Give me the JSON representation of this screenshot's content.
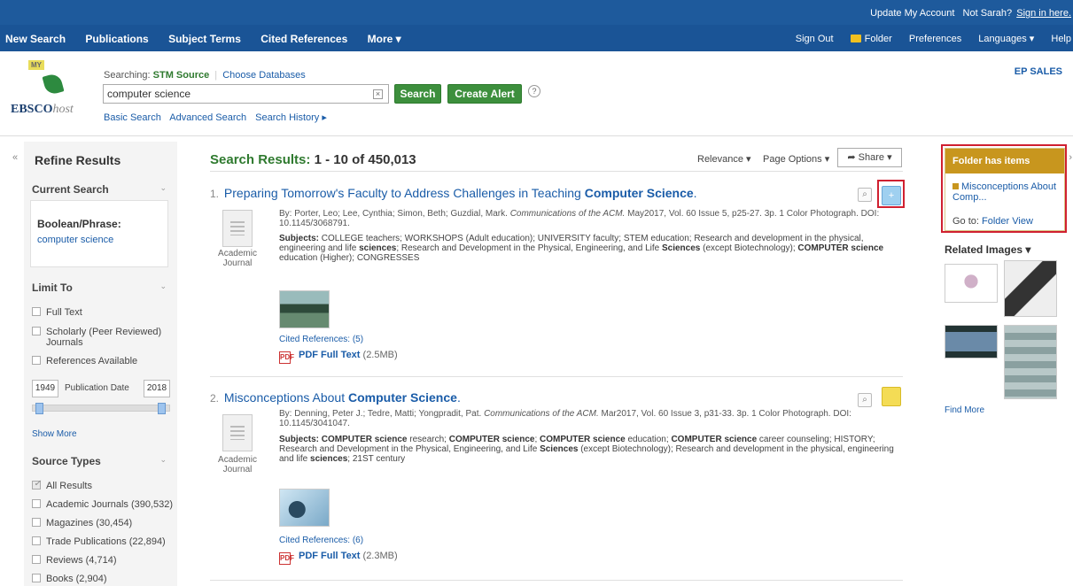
{
  "topbar": {
    "update_account": "Update My Account",
    "not_user": "Not Sarah?",
    "sign_in": "Sign in here."
  },
  "nav": {
    "left": [
      "New Search",
      "Publications",
      "Subject Terms",
      "Cited References",
      "More ▾"
    ],
    "sign_out": "Sign Out",
    "folder": "Folder",
    "preferences": "Preferences",
    "languages": "Languages ▾",
    "help": "Help"
  },
  "header": {
    "logo_my": "MY",
    "logo_brand": "EBSCO",
    "logo_host": "host",
    "searching_label": "Searching:",
    "searching_source": "STM Source",
    "choose_db": "Choose Databases",
    "search_value": "computer science",
    "search_button": "Search",
    "alert_button": "Create Alert",
    "help_glyph": "?",
    "basic_search": "Basic Search",
    "advanced_search": "Advanced Search",
    "search_history": "Search History ▸",
    "ep_sales": "EP SALES"
  },
  "sidebar": {
    "refine": "Refine Results",
    "current_search": "Current Search",
    "boolean_label": "Boolean/Phrase:",
    "boolean_value": "computer science",
    "limit_to": "Limit To",
    "limits": [
      "Full Text",
      "Scholarly (Peer Reviewed)",
      "Journals",
      "References Available"
    ],
    "date_from": "1949",
    "date_label": "Publication Date",
    "date_to": "2018",
    "show_more": "Show More",
    "source_types": "Source Types",
    "sources": [
      "All Results",
      "Academic Journals (390,532)",
      "Magazines (30,454)",
      "Trade Publications (22,894)",
      "Reviews (4,714)",
      "Books (2,904)"
    ]
  },
  "results": {
    "heading": "Search Results:",
    "range": "1 - 10 of 450,013",
    "relevance": "Relevance ▾",
    "page_options": "Page Options ▾",
    "share": "Share ▾",
    "items": [
      {
        "num": "1.",
        "title_plain": "Preparing Tomorrow's Faculty to Address Challenges in Teaching ",
        "title_bold": "Computer Science",
        "title_end": ".",
        "meta_by": "By: Porter, Leo; Lee, Cynthia; Simon, Beth; Guzdial, Mark.",
        "meta_journal": "Communications of the ACM.",
        "meta_rest": "May2017, Vol. 60 Issue 5, p25-27. 3p. 1 Color Photograph. DOI:",
        "meta_doi": "10.1145/3068791.",
        "subjects_label": "Subjects:",
        "subjects_a": "COLLEGE teachers; WORKSHOPS (Adult education); UNIVERSITY faculty; STEM education; Research and development in the physical, engineering and life ",
        "subjects_b": "sciences",
        "subjects_c": "; Research and Development in the Physical, Engineering, and Life ",
        "subjects_d": "Sciences",
        "subjects_e": " (except Biotechnology); ",
        "subjects_f": "COMPUTER science",
        "subjects_g": " education (Higher); CONGRESSES",
        "type": "Academic Journal",
        "cited": "Cited References: (5)",
        "pdf_label": "PDF Full Text",
        "pdf_size": "(2.5MB)"
      },
      {
        "num": "2.",
        "title_plain": "Misconceptions About ",
        "title_bold": "Computer Science",
        "title_end": ".",
        "meta_by": "By: Denning, Peter J.; Tedre, Matti; Yongpradit, Pat.",
        "meta_journal": "Communications of the ACM.",
        "meta_rest": "Mar2017, Vol. 60 Issue 3, p31-33. 3p. 1 Color Photograph. DOI:",
        "meta_doi": "10.1145/3041047.",
        "subjects_label": "Subjects:",
        "subjects_a": "COMPUTER science",
        "subjects_b": " research; ",
        "subjects_c": "COMPUTER science",
        "subjects_d": "; ",
        "subjects_e": "COMPUTER science",
        "subjects_f": " education; ",
        "subjects_g": "COMPUTER science",
        "subjects_h": " career counseling; HISTORY; Research and Development in the Physical, Engineering, and Life ",
        "subjects_i": "Sciences",
        "subjects_j": " (except Biotechnology); Research and development in the physical, engineering and life ",
        "subjects_k": "sciences",
        "subjects_l": "; 21ST century",
        "type": "Academic Journal",
        "cited": "Cited References: (6)",
        "pdf_label": "PDF Full Text",
        "pdf_size": "(2.3MB)"
      }
    ]
  },
  "right": {
    "folder_has_items": "Folder has items",
    "folder_item": "Misconceptions About Comp...",
    "go_to": "Go to:",
    "folder_view": "Folder View",
    "related_images": "Related Images ▾",
    "find_more": "Find More"
  },
  "colors": {
    "topbar": "#1e5a9c",
    "link": "#1a5ca8",
    "green": "#3d8f3d",
    "folder_gold": "#c8961e",
    "highlight_red": "#d02030"
  },
  "icons": [
    "folder-icon",
    "clear-icon",
    "help-icon",
    "collapse-icon",
    "checkbox-icon",
    "slider-handle-icon",
    "magnify-icon",
    "add-to-folder-icon",
    "pdf-icon",
    "document-icon",
    "share-icon"
  ]
}
